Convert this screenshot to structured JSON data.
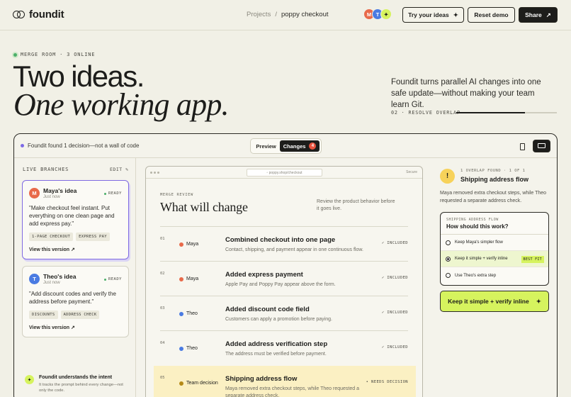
{
  "brand": {
    "name": "foundit"
  },
  "breadcrumb": {
    "parent": "Projects",
    "sep": "/",
    "current": "poppy checkout"
  },
  "presence": [
    {
      "initial": "M",
      "color": "#e86a4a"
    },
    {
      "initial": "T",
      "color": "#4a7be2"
    },
    {
      "initial": "✦",
      "color": "#d6f35e"
    }
  ],
  "header": {
    "try_label": "Try your ideas",
    "try_icon": "✦",
    "reset_label": "Reset demo",
    "share_label": "Share",
    "share_icon": "↗"
  },
  "hero": {
    "tag": "MERGE ROOM · 3 ONLINE",
    "line1": "Two ideas.",
    "line2": "One working app.",
    "lede": "Foundit turns parallel AI changes into one safe update—without making your team learn Git.",
    "step": "02 · RESOLVE OVERLAP",
    "step_progress": 0.68
  },
  "app": {
    "found": "Foundit found 1 decision—not a wall of code",
    "tabs": {
      "preview": "Preview",
      "changes": "Changes",
      "changes_count": "4"
    },
    "branches": {
      "heading": "LIVE BRANCHES",
      "edit": "EDIT ✎",
      "items": [
        {
          "initial": "M",
          "color": "#e86a4a",
          "title": "Maya's idea",
          "time": "Just now",
          "status": "READY",
          "quote": "\"Make checkout feel instant. Put everything on one clean page and add express pay.\"",
          "chips": [
            "1-PAGE CHECKOUT",
            "EXPRESS PAY"
          ],
          "link": "View this version ↗"
        },
        {
          "initial": "T",
          "color": "#4a7be2",
          "title": "Theo's idea",
          "time": "Just now",
          "status": "READY",
          "quote": "\"Add discount codes and verify the address before payment.\"",
          "chips": [
            "DISCOUNTS",
            "ADDRESS CHECK"
          ],
          "link": "View this version ↗"
        }
      ],
      "intent_title": "Foundit understands the intent",
      "intent_desc": "It tracks the prompt behind every change—not only the code.",
      "intent_icon": "✦"
    },
    "review": {
      "url": "▫ poppy.shop/checkout",
      "secure": "Secure",
      "kicker": "MERGE REVIEW",
      "title": "What will change",
      "note": "Review the product behavior before it goes live.",
      "rows": [
        {
          "n": "01",
          "who": "Maya",
          "color": "#e86a4a",
          "title": "Combined checkout into one page",
          "desc": "Contact, shipping, and payment appear in one continuous flow.",
          "status": "✓ INCLUDED"
        },
        {
          "n": "02",
          "who": "Maya",
          "color": "#e86a4a",
          "title": "Added express payment",
          "desc": "Apple Pay and Poppy Pay appear above the form.",
          "status": "✓ INCLUDED"
        },
        {
          "n": "03",
          "who": "Theo",
          "color": "#4a7be2",
          "title": "Added discount code field",
          "desc": "Customers can apply a promotion before paying.",
          "status": "✓ INCLUDED"
        },
        {
          "n": "04",
          "who": "Theo",
          "color": "#4a7be2",
          "title": "Added address verification step",
          "desc": "The address must be verified before payment.",
          "status": "✓ INCLUDED"
        },
        {
          "n": "05",
          "who": "Team decision",
          "color": "#b58a18",
          "title": "Shipping address flow",
          "desc": "Maya removed extra checkout steps, while Theo requested a separate address check.",
          "status": "• NEEDS DECISION"
        }
      ]
    },
    "decision": {
      "icon": "!",
      "kicker": "1 OVERLAP FOUND · 1 OF 1",
      "title": "Shipping address flow",
      "desc": "Maya removed extra checkout steps, while Theo requested a separate address check.",
      "q_kicker": "SHIPPING ADDRESS FLOW",
      "question": "How should this work?",
      "options": [
        {
          "label": "Keep Maya's simpler flow",
          "selected": false
        },
        {
          "label": "Keep it simple + verify inline",
          "selected": true,
          "badge": "BEST FIT"
        },
        {
          "label": "Use Theo's extra step",
          "selected": false
        }
      ],
      "cta": "Keep it simple + verify inline",
      "cta_icon": "✦"
    }
  }
}
